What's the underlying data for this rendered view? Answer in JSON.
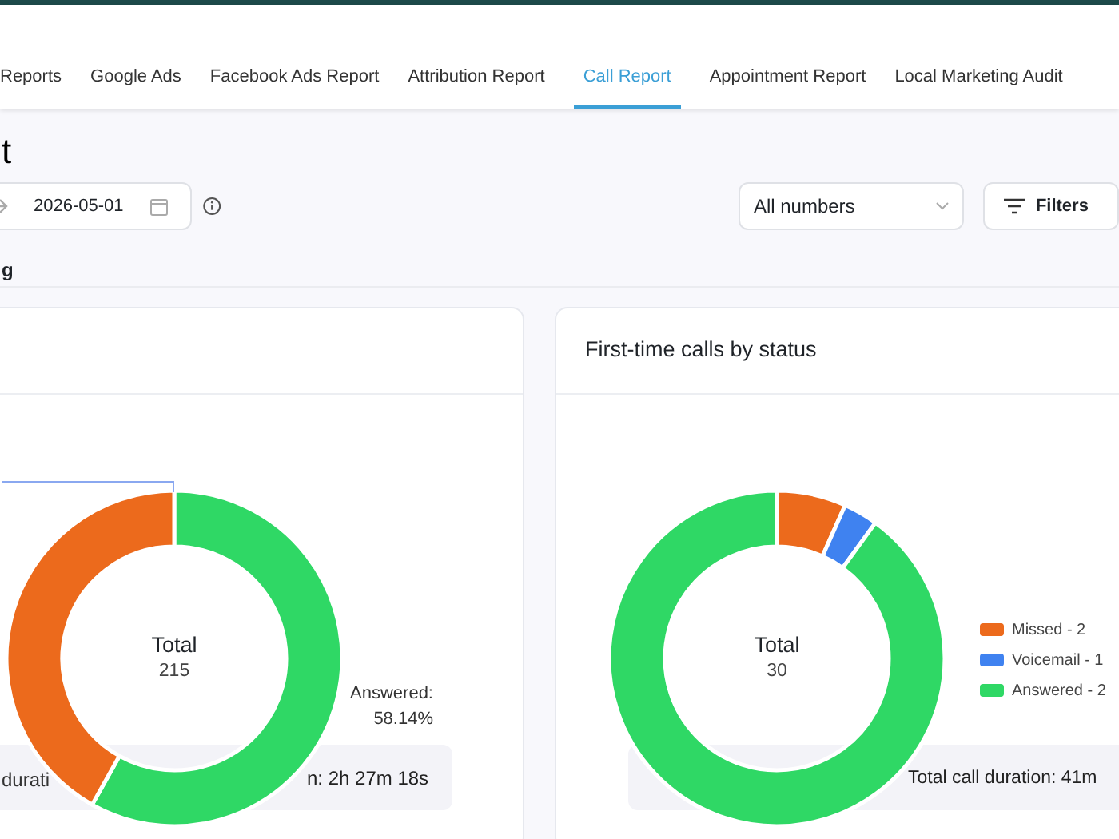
{
  "tabs": [
    {
      "label": "Reports",
      "selected": false
    },
    {
      "label": "Google Ads",
      "selected": false
    },
    {
      "label": "Facebook Ads Report",
      "selected": false
    },
    {
      "label": "Attribution Report",
      "selected": false
    },
    {
      "label": "Call Report",
      "selected": true
    },
    {
      "label": "Appointment Report",
      "selected": false
    },
    {
      "label": "Local Marketing Audit",
      "selected": false
    }
  ],
  "page_title": "t",
  "date_field": {
    "value": "2026-05-01"
  },
  "number_select": {
    "value": "All numbers"
  },
  "filters_button": "Filters",
  "section_label": "g",
  "cards": [
    {
      "center_label": "Total",
      "center_value": "215",
      "data_label": "Answered:\n58.14%",
      "duration_left": "durati",
      "duration_right": "n: 2h 27m 18s",
      "chart_data": {
        "type": "donut",
        "values": [
          58.14,
          41.86
        ],
        "colors": [
          "#2fd865",
          "#ec6a1c"
        ]
      }
    },
    {
      "title": "First-time calls by status",
      "center_label": "Total",
      "center_value": "30",
      "legend": [
        {
          "label": "Missed - 2",
          "color": "#ec6a1c"
        },
        {
          "label": "Voicemail - 1",
          "color": "#3f82f0"
        },
        {
          "label": "Answered - 2",
          "color": "#2fd865"
        }
      ],
      "duration_right": "Total call duration: 41m",
      "chart_data": {
        "type": "donut",
        "values": [
          6.67,
          3.33,
          90
        ],
        "colors": [
          "#ec6a1c",
          "#3f82f0",
          "#2fd865"
        ]
      }
    }
  ]
}
